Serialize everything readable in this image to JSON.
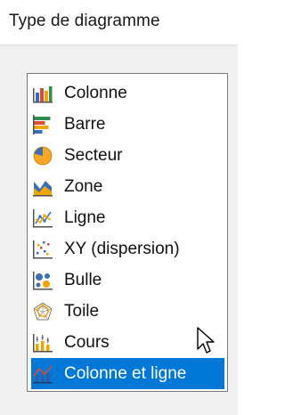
{
  "header": {
    "title": "Type de diagramme"
  },
  "chart_types": {
    "selected_index": 9,
    "items": [
      {
        "label": "Colonne",
        "icon": "column-chart-icon"
      },
      {
        "label": "Barre",
        "icon": "bar-chart-icon"
      },
      {
        "label": "Secteur",
        "icon": "pie-chart-icon"
      },
      {
        "label": "Zone",
        "icon": "area-chart-icon"
      },
      {
        "label": "Ligne",
        "icon": "line-chart-icon"
      },
      {
        "label": "XY (dispersion)",
        "icon": "scatter-chart-icon"
      },
      {
        "label": "Bulle",
        "icon": "bubble-chart-icon"
      },
      {
        "label": "Toile",
        "icon": "net-chart-icon"
      },
      {
        "label": "Cours",
        "icon": "stock-chart-icon"
      },
      {
        "label": "Colonne et ligne",
        "icon": "column-and-line-chart-icon"
      }
    ]
  },
  "colors": {
    "selection": "#0078d7",
    "list_border": "#7a7a7a",
    "panel_background": "#f0f0f0"
  }
}
